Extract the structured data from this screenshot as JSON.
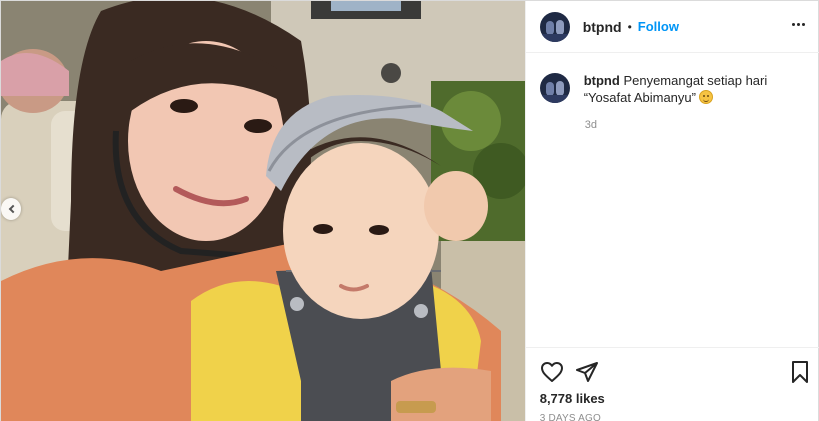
{
  "post": {
    "username": "btpnd",
    "follow_label": "Follow",
    "separator": "•",
    "caption_text": "Penyemangat setiap hari “Yosafat Abimanyu”",
    "caption_emoji": "hugging-face-emoji",
    "caption_time": "3d",
    "likes": "8,778 likes",
    "date": "3 DAYS AGO"
  },
  "icons": {
    "more": "more-options-icon",
    "like": "heart-icon",
    "share": "paper-plane-icon",
    "save": "bookmark-icon",
    "prev": "chevron-left-icon"
  },
  "colors": {
    "accent": "#0095f6",
    "text": "#262626",
    "muted": "#8e8e8e",
    "divider": "#efefef"
  }
}
